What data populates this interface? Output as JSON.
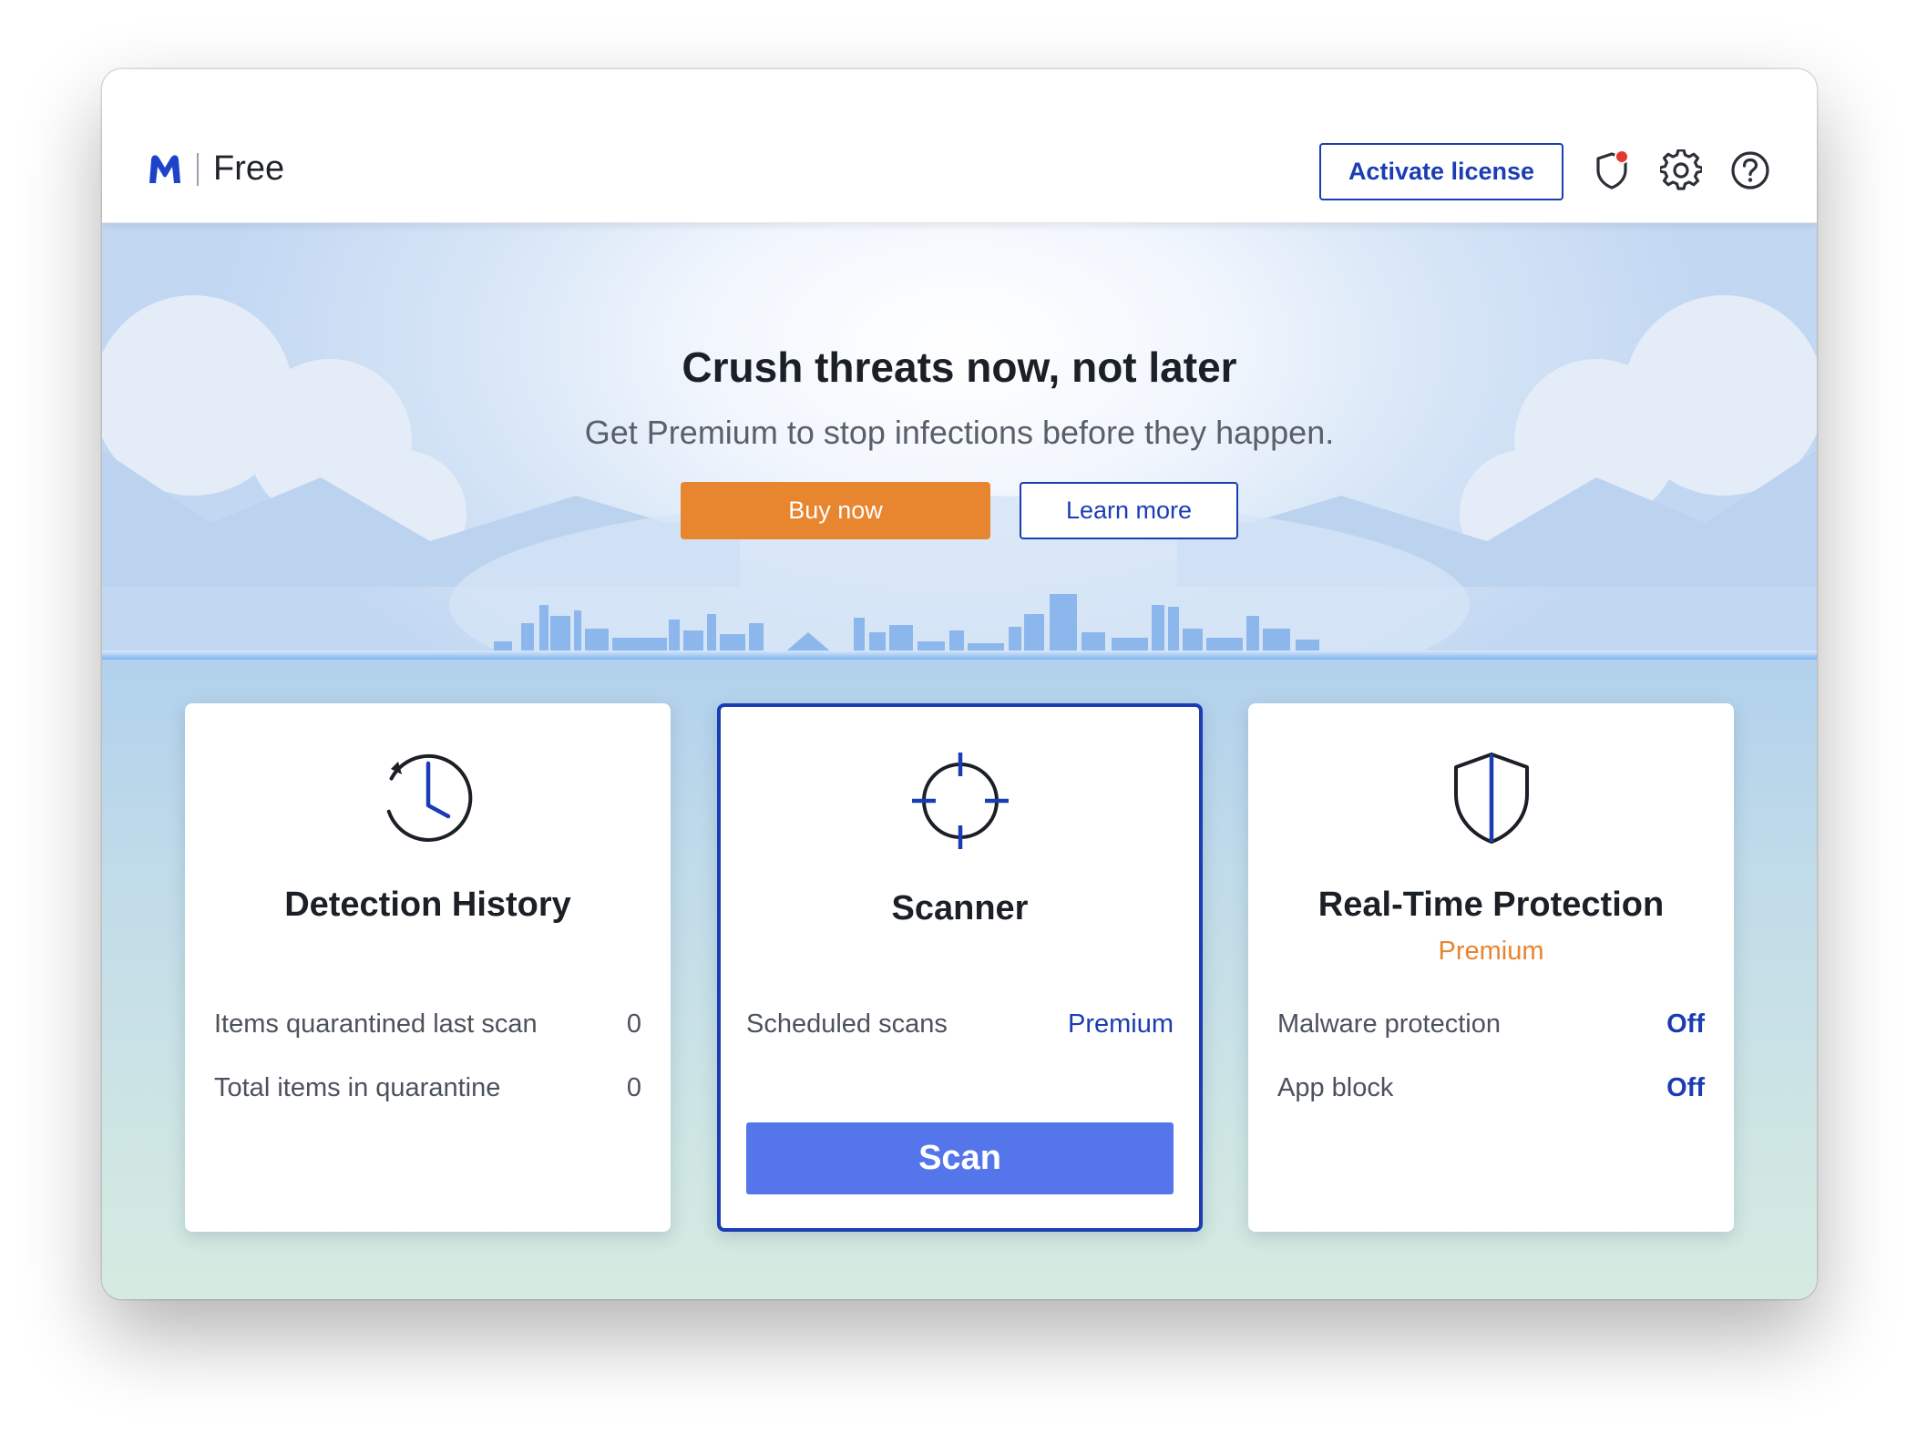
{
  "app": {
    "plan_label": "Free",
    "brand_icon": "malwarebytes-logo-icon"
  },
  "header": {
    "activate_label": "Activate license",
    "icons": [
      "shield-alert-icon",
      "gear-icon",
      "help-icon"
    ],
    "alert_color": "#e03a2c"
  },
  "hero": {
    "title": "Crush threats now, not later",
    "subtitle": "Get Premium to stop infections before they happen.",
    "buy_label": "Buy now",
    "learn_label": "Learn more"
  },
  "cards": {
    "history": {
      "icon": "history-clock-icon",
      "title": "Detection History",
      "rows": [
        {
          "label": "Items quarantined last scan",
          "value": "0"
        },
        {
          "label": "Total items in quarantine",
          "value": "0"
        }
      ]
    },
    "scanner": {
      "icon": "crosshair-icon",
      "title": "Scanner",
      "rows": [
        {
          "label": "Scheduled scans",
          "value": "Premium"
        }
      ],
      "scan_label": "Scan"
    },
    "protection": {
      "icon": "shield-icon",
      "title": "Real-Time Protection",
      "badge": "Premium",
      "rows": [
        {
          "label": "Malware protection",
          "value": "Off"
        },
        {
          "label": "App block",
          "value": "Off"
        }
      ]
    }
  },
  "colors": {
    "brand_blue": "#1b3db3",
    "accent_orange": "#e8852f",
    "scan_button": "#5476ea"
  }
}
